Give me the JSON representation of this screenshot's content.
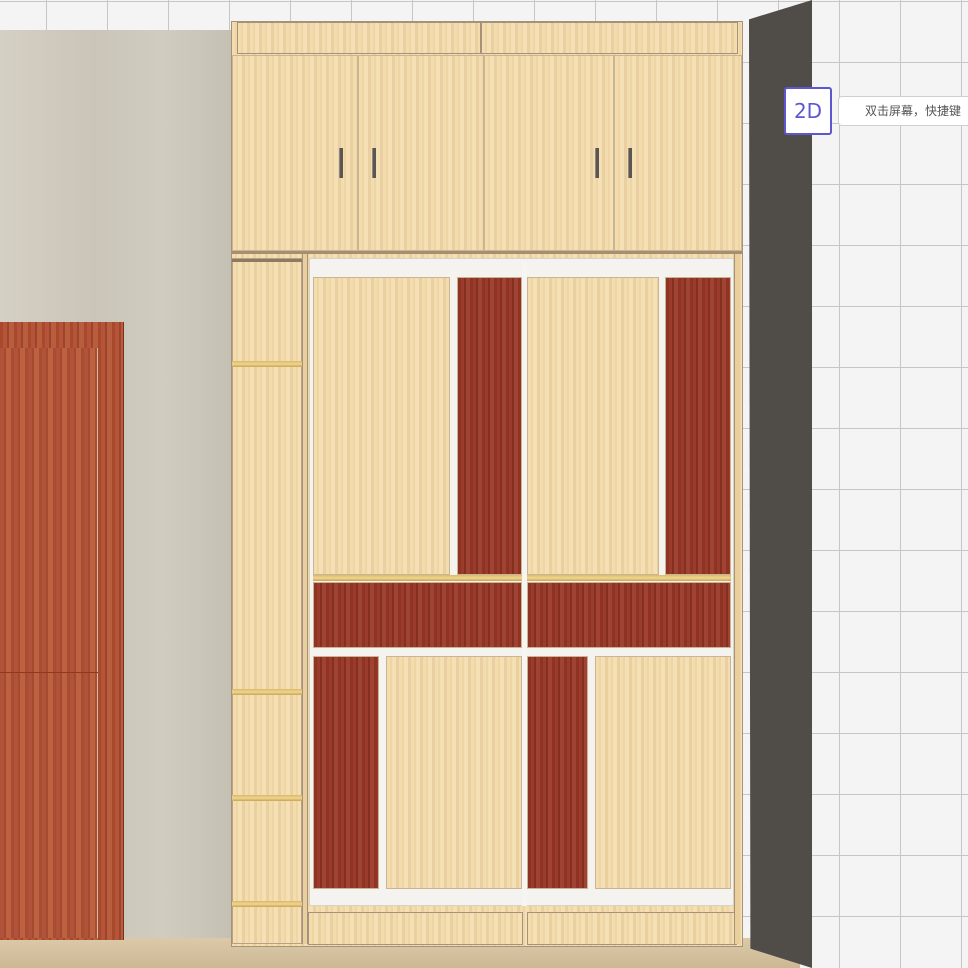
{
  "viewport": {
    "mode_toggle_label": "2D",
    "hint_text": "双击屏幕，快捷键"
  },
  "colors": {
    "accent": "#5d57cf",
    "light_wood": "#f1d9aa",
    "dark_wood": "#92372a",
    "side_wall": "#504d48"
  },
  "icons": [
    "handle-icon"
  ]
}
